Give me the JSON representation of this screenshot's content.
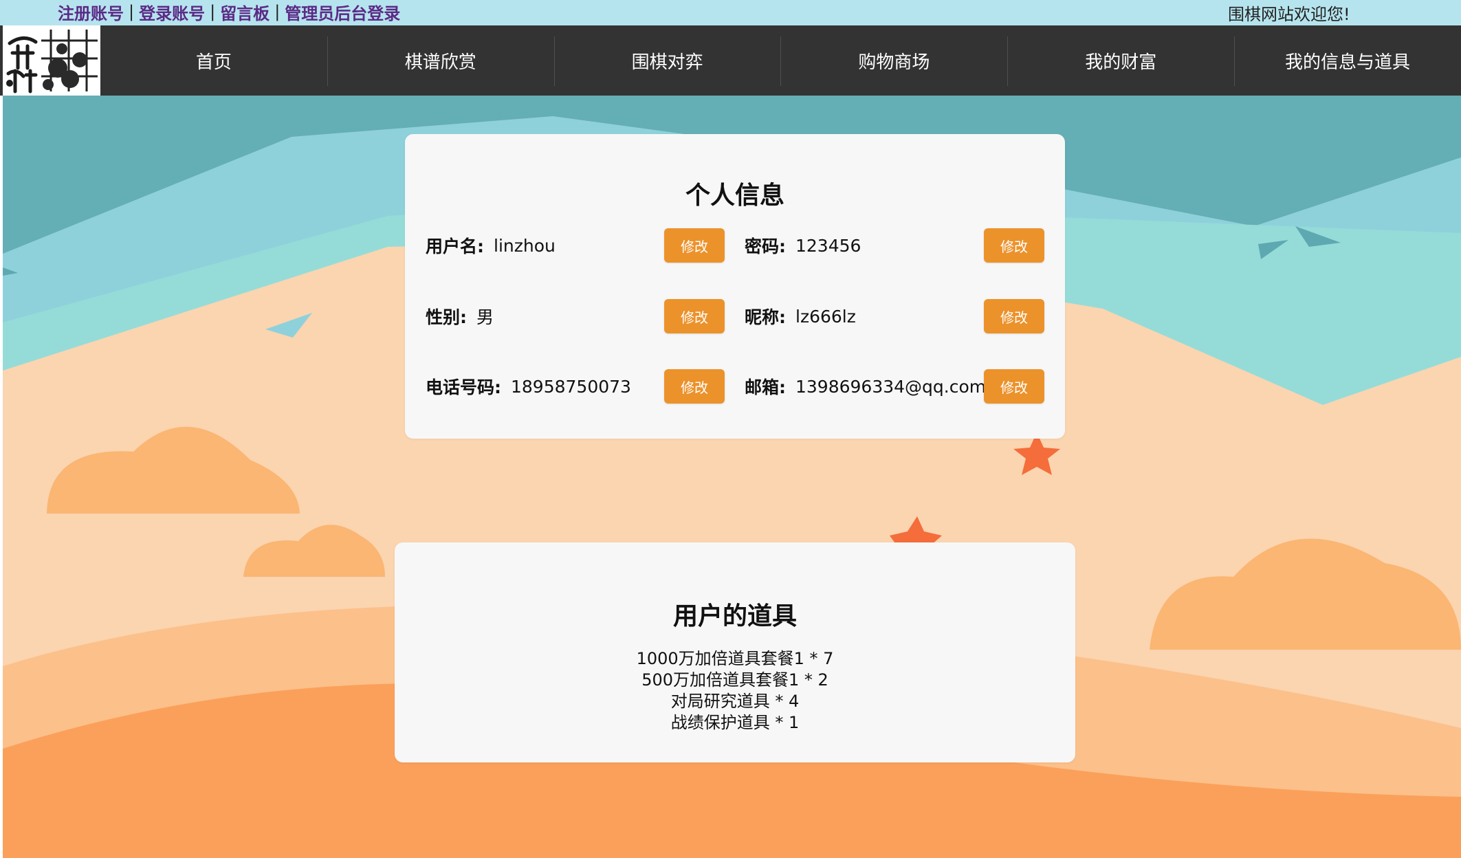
{
  "top_links": [
    {
      "label": "注册账号"
    },
    {
      "label": "登录账号"
    },
    {
      "label": "留言板"
    },
    {
      "label": "管理员后台登录"
    }
  ],
  "top_separator": "|",
  "welcome_text": "围棋网站欢迎您!",
  "nav_items": [
    {
      "label": "首页"
    },
    {
      "label": "棋谱欣赏"
    },
    {
      "label": "围棋对弈"
    },
    {
      "label": "购物商场"
    },
    {
      "label": "我的财富"
    },
    {
      "label": "我的信息与道具"
    }
  ],
  "profile": {
    "title": "个人信息",
    "edit_label": "修改",
    "fields": [
      {
        "label": "用户名:",
        "value": "linzhou"
      },
      {
        "label": "密码:",
        "value": "123456"
      },
      {
        "label": "性别:",
        "value": "男"
      },
      {
        "label": "昵称:",
        "value": "lz666lz"
      },
      {
        "label": "电话号码:",
        "value": "18958750073"
      },
      {
        "label": "邮箱:",
        "value": "1398696334@qq.com"
      }
    ]
  },
  "props": {
    "title": "用户的道具",
    "items": [
      "1000万加倍道具套餐1 * 7",
      "500万加倍道具套餐1 * 2",
      "对局研究道具 * 4",
      "战绩保护道具 * 1"
    ]
  },
  "colors": {
    "top_strip": "#b6e4ee",
    "link": "#5b2a86",
    "nav_bg": "#333333",
    "button": "#ec922b",
    "card": "#f7f7f7"
  }
}
